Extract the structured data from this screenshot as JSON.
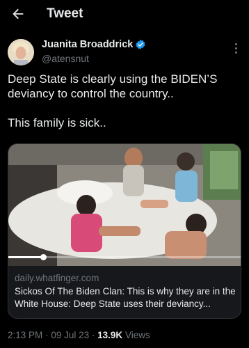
{
  "header": {
    "title": "Tweet",
    "back_icon": "arrow-left-icon"
  },
  "author": {
    "display_name": "Juanita Broaddrick",
    "handle": "@atensnut",
    "verified_color": "#1d9bf0"
  },
  "tweet": {
    "text": "Deep State is clearly using the BIDEN’S deviancy to control the country..\n\nThis family is sick.."
  },
  "card": {
    "domain": "daily.whatfinger.com",
    "title": "Sickos Of The Biden Clan: This is why they are in the White House: Deep State uses their deviancy...",
    "playback_progress": 0.15
  },
  "meta": {
    "time": "2:13 PM",
    "separator": "·",
    "date": "09 Jul 23",
    "views_count": "13.9K",
    "views_label": "Views"
  }
}
